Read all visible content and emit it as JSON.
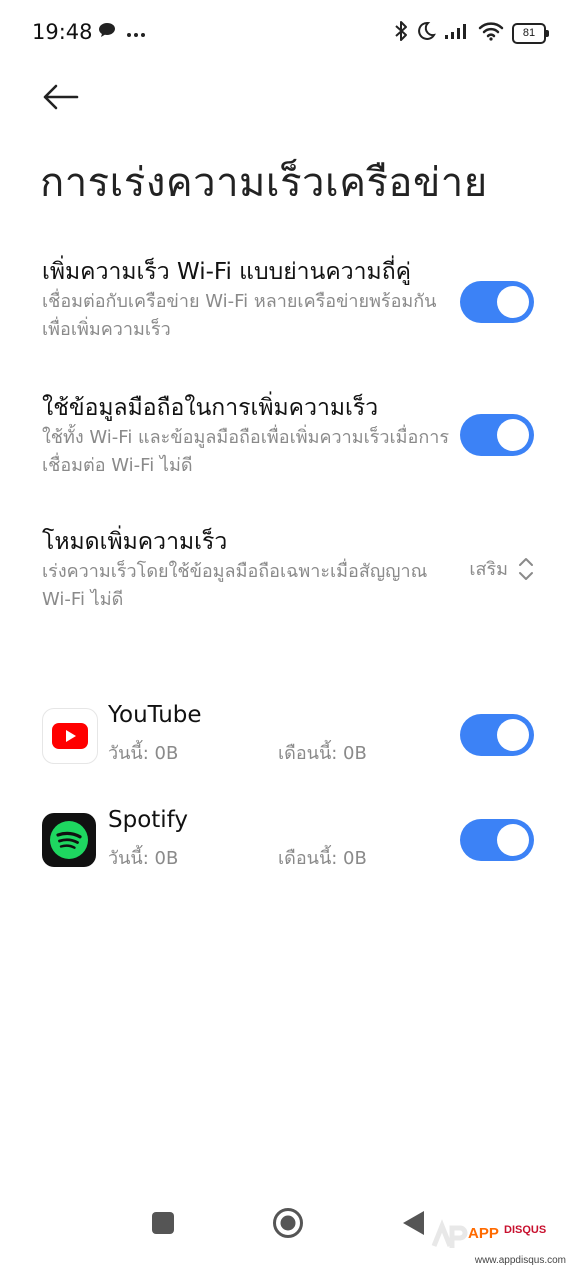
{
  "status_bar": {
    "time": "19:48",
    "battery": "81",
    "icons": [
      "chat-bubble-icon",
      "more-dots-icon",
      "bluetooth-icon",
      "moon-icon",
      "signal-icon",
      "wifi-icon",
      "battery-icon"
    ]
  },
  "header": {
    "title": "การเร่งความเร็วเครือข่าย"
  },
  "settings": [
    {
      "title": "เพิ่มความเร็ว Wi-Fi แบบย่านความถี่คู่",
      "desc": "เชื่อมต่อกับเครือข่าย Wi-Fi หลายเครือข่ายพร้อมกันเพื่อเพิ่มความเร็ว",
      "enabled": true
    },
    {
      "title": "ใช้ข้อมูลมือถือในการเพิ่มความเร็ว",
      "desc": "ใช้ทั้ง Wi-Fi และข้อมูลมือถือเพื่อเพิ่มความเร็วเมื่อการเชื่อมต่อ Wi-Fi ไม่ดี",
      "enabled": true
    }
  ],
  "mode": {
    "title": "โหมดเพิ่มความเร็ว",
    "desc": "เร่งความเร็วโดยใช้ข้อมูลมือถือเฉพาะเมื่อสัญญาณ Wi-Fi ไม่ดี",
    "value": "เสริม"
  },
  "apps": [
    {
      "name": "YouTube",
      "today": "วันนี้: 0B",
      "month": "เดือนนี้: 0B",
      "enabled": true,
      "icon": "youtube-icon"
    },
    {
      "name": "Spotify",
      "today": "วันนี้: 0B",
      "month": "เดือนนี้: 0B",
      "enabled": true,
      "icon": "spotify-icon"
    }
  ],
  "watermark": {
    "brand": "APPDISQUS",
    "url": "www.appdisqus.com"
  },
  "colors": {
    "toggle_on": "#3c82f6",
    "youtube_red": "#ff0000",
    "spotify_green": "#1ed760"
  }
}
